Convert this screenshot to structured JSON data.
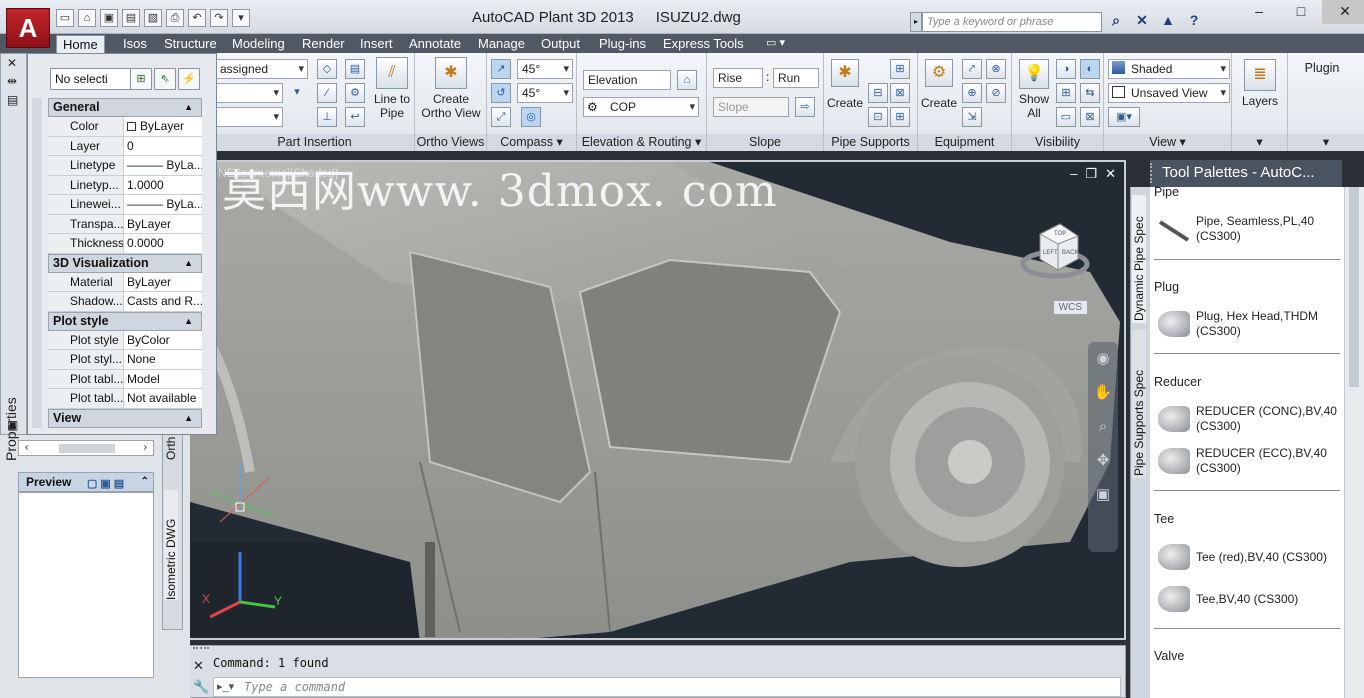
{
  "window": {
    "app_name": "AutoCAD Plant 3D 2013",
    "file_name": "ISUZU2.dwg",
    "search_placeholder": "Type a keyword or phrase",
    "controls": [
      "–",
      "□",
      "✕"
    ]
  },
  "quick_access": [
    "new-icon",
    "open-icon",
    "save-icon",
    "saveas-icon",
    "plot-preview-icon",
    "print-icon",
    "undo-icon",
    "redo-icon",
    "customize-icon"
  ],
  "ribbon_tabs": [
    "Home",
    "Isos",
    "Structure",
    "Modeling",
    "Render",
    "Insert",
    "Annotate",
    "Manage",
    "Output",
    "Plug-ins",
    "Express Tools"
  ],
  "ribbon": {
    "part_insertion": {
      "label": "Part Insertion",
      "combo1": "assigned",
      "line_to_pipe": "Line to\nPipe"
    },
    "ortho_views": {
      "label": "Ortho Views",
      "create": "Create\nOrtho View"
    },
    "compass": {
      "label": "Compass",
      "angle1": "45°",
      "angle2": "45°"
    },
    "elevation": {
      "label": "Elevation & Routing",
      "elevation_field": "Elevation",
      "cop_field": "COP"
    },
    "slope": {
      "label": "Slope",
      "rise": "Rise",
      "run": "Run",
      "slope_field": "Slope",
      "colon": ":"
    },
    "pipe_supports": {
      "label": "Pipe Supports",
      "create": "Create"
    },
    "equipment": {
      "label": "Equipment",
      "create": "Create"
    },
    "visibility": {
      "label": "Visibility",
      "show_all": "Show\nAll"
    },
    "view": {
      "label": "View",
      "visual_style": "Shaded",
      "saved_view": "Unsaved View"
    },
    "layers": {
      "label": "Layers"
    },
    "plugin": {
      "label": "Plugin"
    }
  },
  "properties": {
    "palette_title": "Properties",
    "selection": "No selecti",
    "sections": [
      {
        "title": "General",
        "rows": [
          {
            "k": "Color",
            "v": "ByLayer"
          },
          {
            "k": "Layer",
            "v": "0"
          },
          {
            "k": "Linetype",
            "v": "——— ByLa..."
          },
          {
            "k": "Linetyp...",
            "v": "1.0000"
          },
          {
            "k": "Linewei...",
            "v": "——— ByLa..."
          },
          {
            "k": "Transpa...",
            "v": "ByLayer"
          },
          {
            "k": "Thickness",
            "v": "0.0000"
          }
        ]
      },
      {
        "title": "3D Visualization",
        "rows": [
          {
            "k": "Material",
            "v": "ByLayer"
          },
          {
            "k": "Shadow...",
            "v": "Casts and R..."
          }
        ]
      },
      {
        "title": "Plot style",
        "rows": [
          {
            "k": "Plot style",
            "v": "ByColor"
          },
          {
            "k": "Plot styl...",
            "v": "None"
          },
          {
            "k": "Plot tabl...",
            "v": "Model"
          },
          {
            "k": "Plot tabl...",
            "v": "Not available"
          }
        ]
      },
      {
        "title": "View",
        "rows": []
      }
    ]
  },
  "left_panel": {
    "preview_title": "Preview",
    "tab_orth": "Orth",
    "tab_iso": "Isometric DWG"
  },
  "viewport": {
    "label": "NE Isometric][Shaded]",
    "watermark": "莫西网www. 3dmox. com",
    "wcs": "WCS",
    "viewcube_faces": [
      "TOP",
      "LEFT",
      "BACK"
    ],
    "axis_labels": [
      "X",
      "Y"
    ]
  },
  "tool_palettes": {
    "title": "Tool Palettes - AutoC...",
    "tabs": [
      "Dynamic Pipe Spec",
      "Pipe Supports Spec"
    ],
    "groups": [
      {
        "title": "Pipe",
        "items": [
          "Pipe, Seamless,PL,40\n(CS300)"
        ]
      },
      {
        "title": "Plug",
        "items": [
          "Plug, Hex Head,THDM\n(CS300)"
        ]
      },
      {
        "title": "Reducer",
        "items": [
          "REDUCER (CONC),BV,40\n(CS300)",
          "REDUCER (ECC),BV,40\n(CS300)"
        ]
      },
      {
        "title": "Tee",
        "items": [
          "Tee (red),BV,40 (CS300)",
          "Tee,BV,40 (CS300)"
        ]
      },
      {
        "title": "Valve",
        "items": []
      }
    ]
  },
  "command": {
    "history": "Command: 1 found",
    "placeholder": "Type a command"
  },
  "colors": {
    "accent": "#c0272d",
    "ribbon_bg": "#e6ebf0",
    "viewport_bg": "#222a34"
  }
}
